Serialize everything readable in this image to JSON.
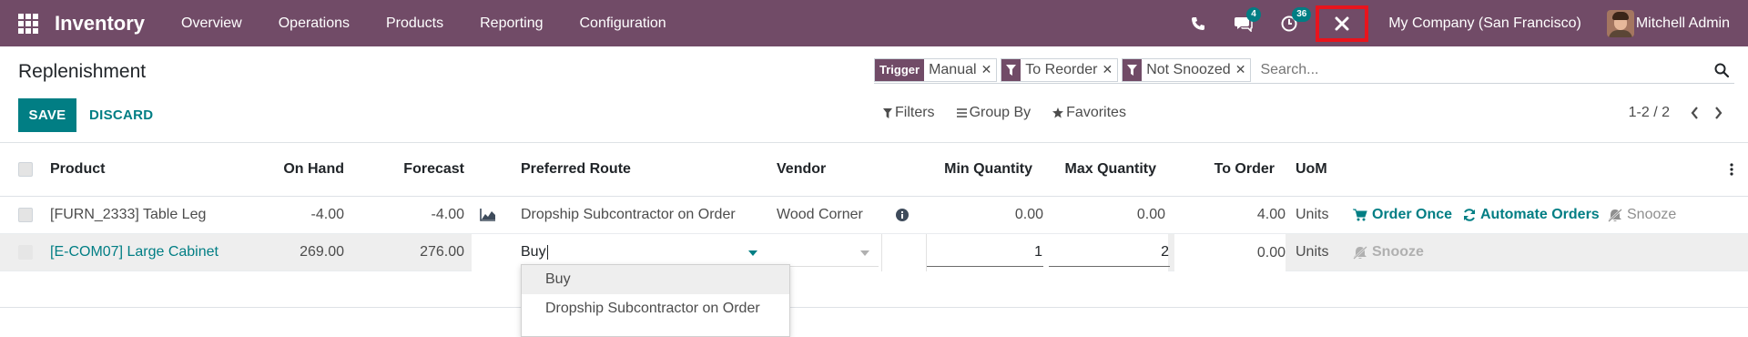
{
  "navbar": {
    "app_name": "Inventory",
    "menu": [
      "Overview",
      "Operations",
      "Products",
      "Reporting",
      "Configuration"
    ],
    "messages_count": "4",
    "activities_count": "36",
    "company": "My Company (San Francisco)",
    "user": "Mitchell Admin"
  },
  "page": {
    "title": "Replenishment",
    "save_label": "SAVE",
    "discard_label": "DISCARD"
  },
  "search": {
    "facets": [
      {
        "label": "Trigger",
        "value": "Manual"
      },
      {
        "label": "filter-icon",
        "value": "To Reorder"
      },
      {
        "label": "filter-icon",
        "value": "Not Snoozed"
      }
    ],
    "placeholder": "Search...",
    "filters_label": "Filters",
    "groupby_label": "Group By",
    "favorites_label": "Favorites"
  },
  "pager": {
    "value": "1-2 / 2"
  },
  "table": {
    "headers": {
      "product": "Product",
      "on_hand": "On Hand",
      "forecast": "Forecast",
      "route": "Preferred Route",
      "vendor": "Vendor",
      "min_qty": "Min Quantity",
      "max_qty": "Max Quantity",
      "to_order": "To Order",
      "uom": "UoM"
    },
    "rows": [
      {
        "product": "[FURN_2333] Table Leg",
        "on_hand": "-4.00",
        "forecast": "-4.00",
        "route": "Dropship Subcontractor on Order",
        "vendor": "Wood Corner",
        "min_qty": "0.00",
        "max_qty": "0.00",
        "to_order": "4.00",
        "uom": "Units",
        "order_once": "Order Once",
        "automate": "Automate Orders",
        "snooze": "Snooze"
      },
      {
        "product": "[E-COM07] Large Cabinet",
        "on_hand": "269.00",
        "forecast": "276.00",
        "route": "Buy",
        "vendor": "",
        "min_qty": "1",
        "max_qty": "2",
        "to_order": "0.00",
        "uom": "Units",
        "snooze": "Snooze"
      }
    ]
  },
  "route_dropdown": {
    "options": [
      "Buy",
      "Dropship Subcontractor on Order"
    ],
    "highlighted": "Buy"
  },
  "colors": {
    "brand": "#714b67",
    "accent": "#017e84",
    "highlight_box": "#e8141d"
  },
  "icons": [
    "apps-icon",
    "phone-icon",
    "chat-icon",
    "clock-icon",
    "close-icon",
    "search-icon",
    "filter-icon",
    "star-icon",
    "list-icon",
    "chevron-left-icon",
    "chevron-right-icon",
    "area-chart-icon",
    "info-icon",
    "cart-icon",
    "refresh-icon",
    "bell-slash-icon",
    "kebab-menu-icon",
    "caret-down-icon"
  ]
}
